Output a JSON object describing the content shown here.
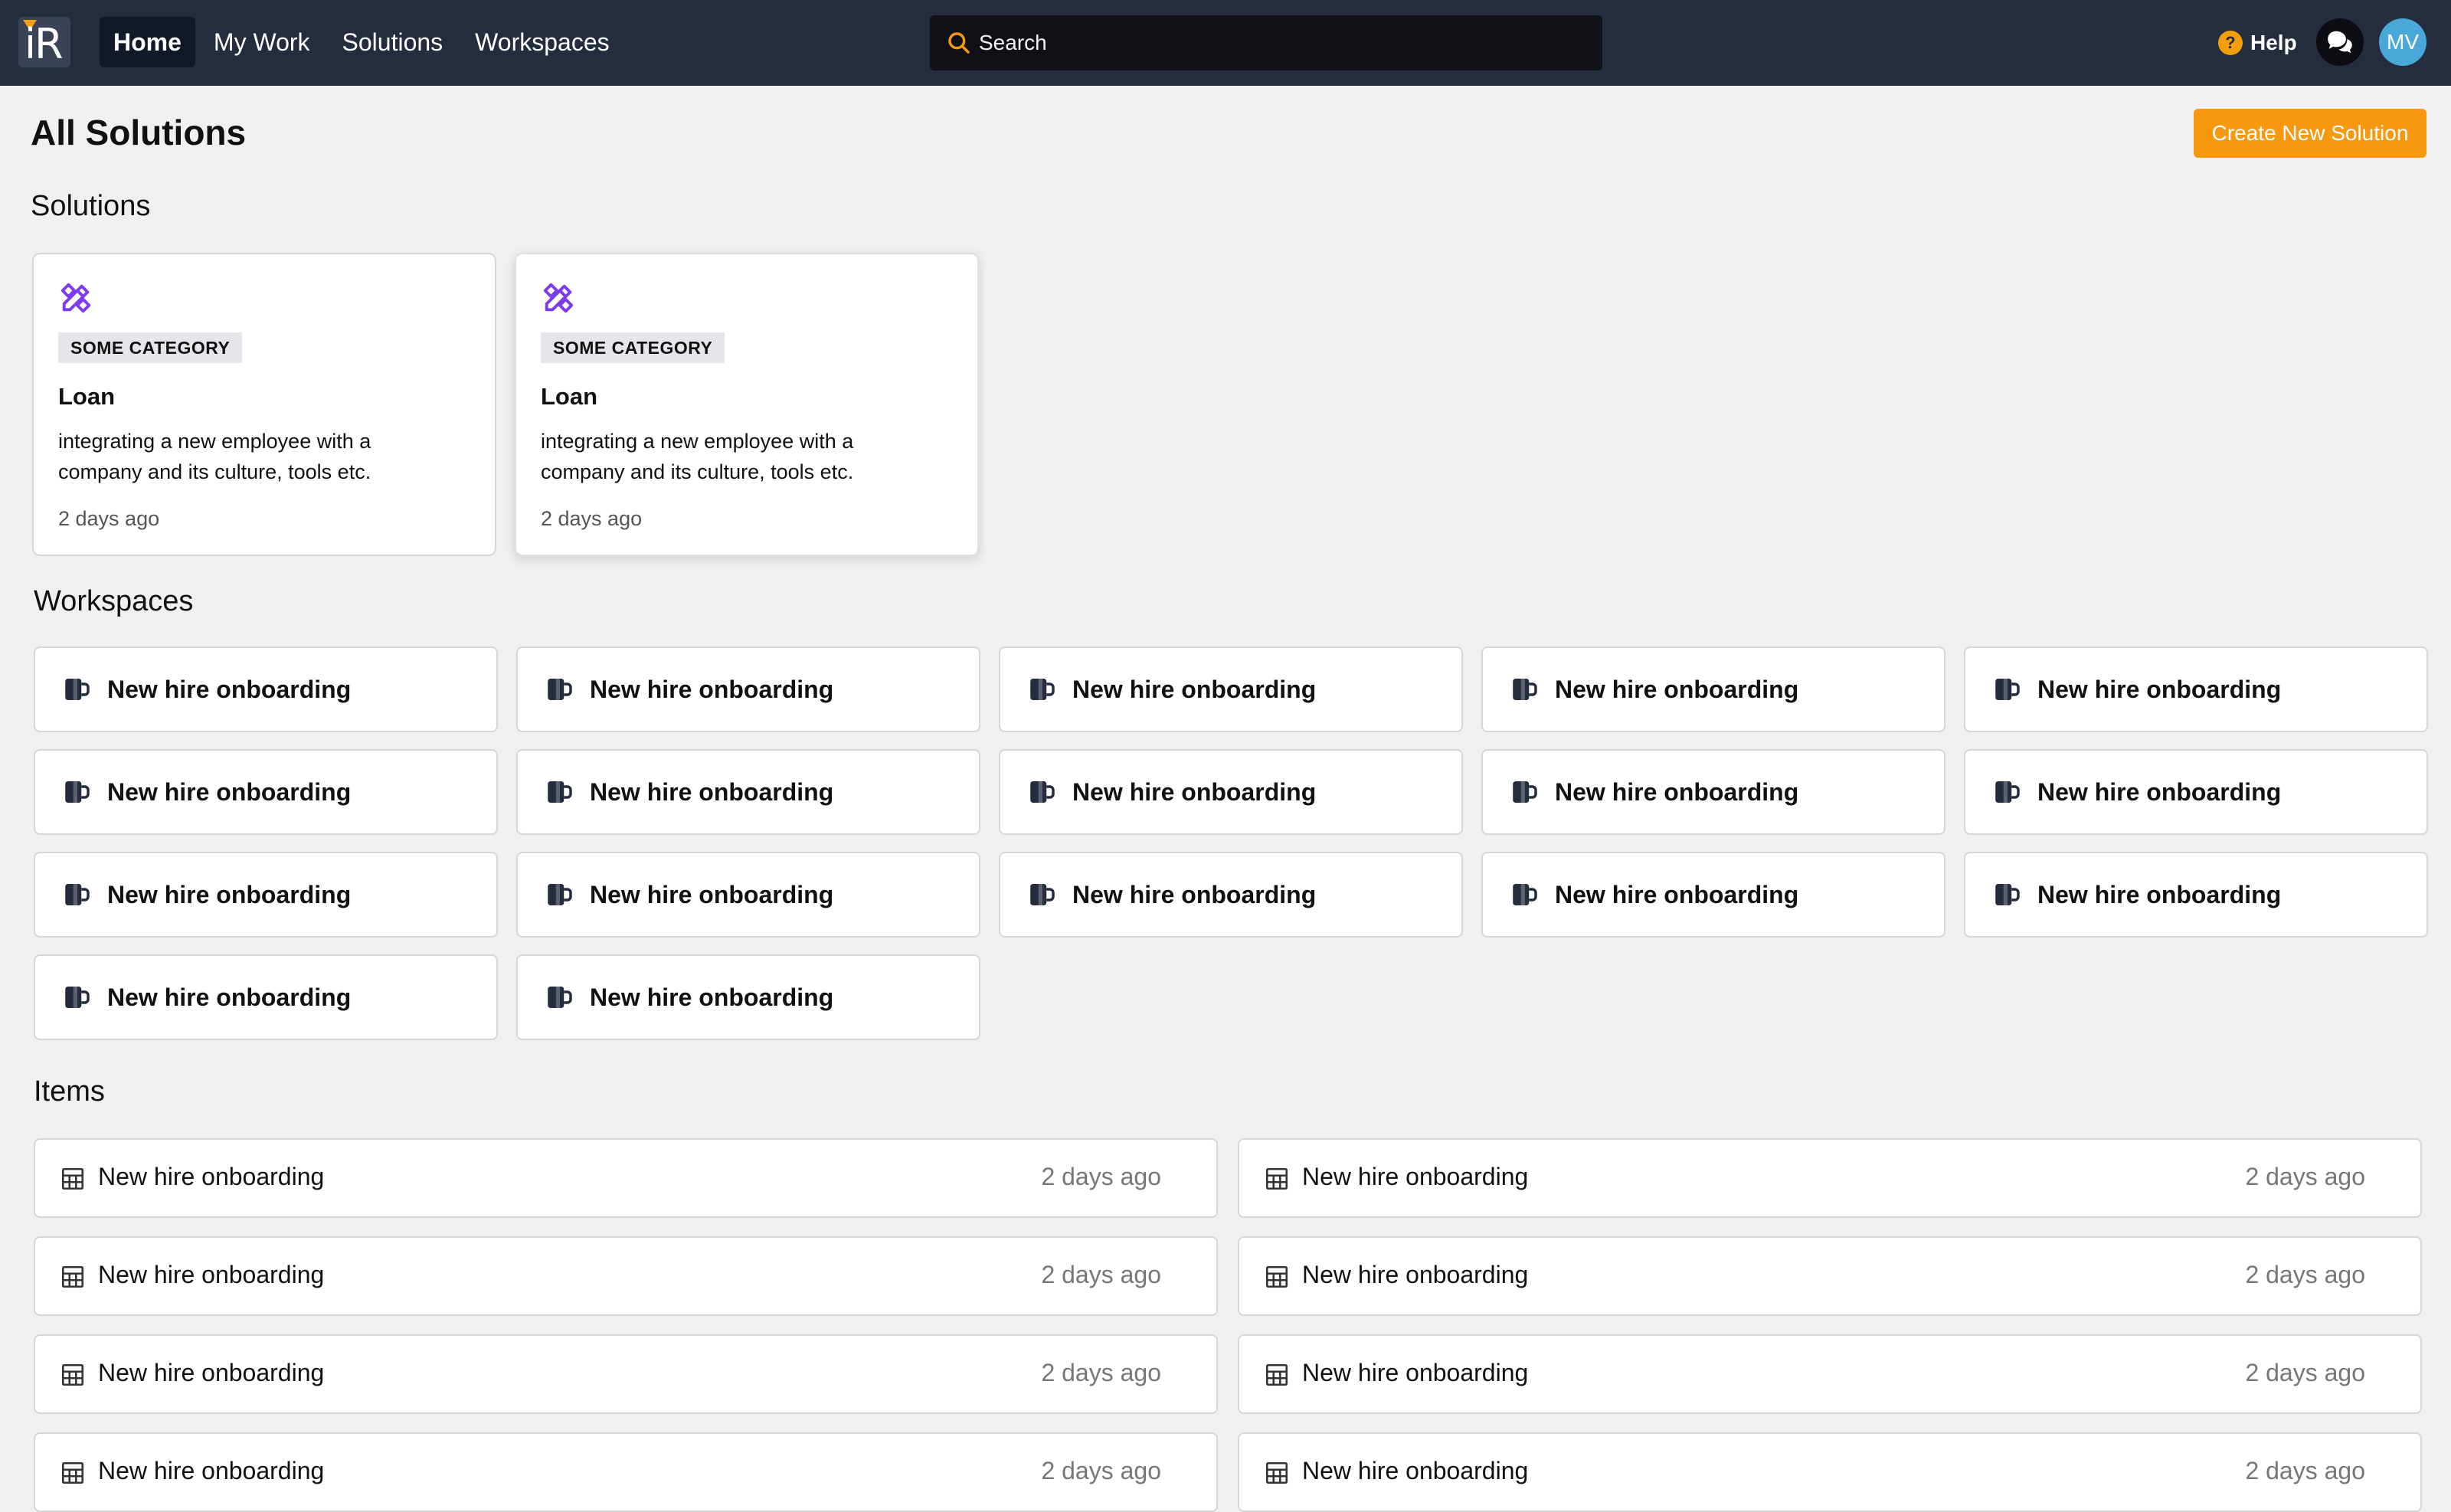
{
  "logo": {
    "text": "iR"
  },
  "nav": [
    {
      "label": "Home",
      "active": true
    },
    {
      "label": "My Work",
      "active": false
    },
    {
      "label": "Solutions",
      "active": false
    },
    {
      "label": "Workspaces",
      "active": false
    }
  ],
  "search": {
    "placeholder": "Search"
  },
  "header_right": {
    "help_label": "Help",
    "help_glyph": "?",
    "avatar_initials": "MV"
  },
  "page": {
    "title": "All Solutions",
    "create_button": "Create New Solution"
  },
  "sections": {
    "solutions": "Solutions",
    "workspaces": "Workspaces",
    "items": "Items"
  },
  "solutions": [
    {
      "category": "SOME CATEGORY",
      "name": "Loan",
      "description": "integrating a new employee with a company and its culture, tools etc.",
      "time": "2 days ago"
    },
    {
      "category": "SOME CATEGORY",
      "name": "Loan",
      "description": "integrating a new employee with a company and its culture, tools etc.",
      "time": "2 days ago"
    }
  ],
  "workspaces": [
    "New hire onboarding",
    "New hire onboarding",
    "New hire onboarding",
    "New hire onboarding",
    "New hire onboarding",
    "New hire onboarding",
    "New hire onboarding",
    "New hire onboarding",
    "New hire onboarding",
    "New hire onboarding",
    "New hire onboarding",
    "New hire onboarding",
    "New hire onboarding",
    "New hire onboarding",
    "New hire onboarding",
    "New hire onboarding",
    "New hire onboarding"
  ],
  "items": [
    {
      "label": "New hire onboarding",
      "time": "2 days ago"
    },
    {
      "label": "New hire onboarding",
      "time": "2 days ago"
    },
    {
      "label": "New hire onboarding",
      "time": "2 days ago"
    },
    {
      "label": "New hire onboarding",
      "time": "2 days ago"
    },
    {
      "label": "New hire onboarding",
      "time": "2 days ago"
    },
    {
      "label": "New hire onboarding",
      "time": "2 days ago"
    },
    {
      "label": "New hire onboarding",
      "time": "2 days ago"
    },
    {
      "label": "New hire onboarding",
      "time": "2 days ago"
    }
  ],
  "colors": {
    "topbar": "#252c3e",
    "accent": "#f7980f",
    "solution_icon": "#7c3aed",
    "avatar": "#4aa8d8"
  },
  "icons": {
    "solution": "tools-icon",
    "workspace": "mug-icon",
    "item": "table-grid-icon",
    "search": "search-icon",
    "help": "help-circle-icon",
    "chat": "chat-bubbles-icon"
  }
}
